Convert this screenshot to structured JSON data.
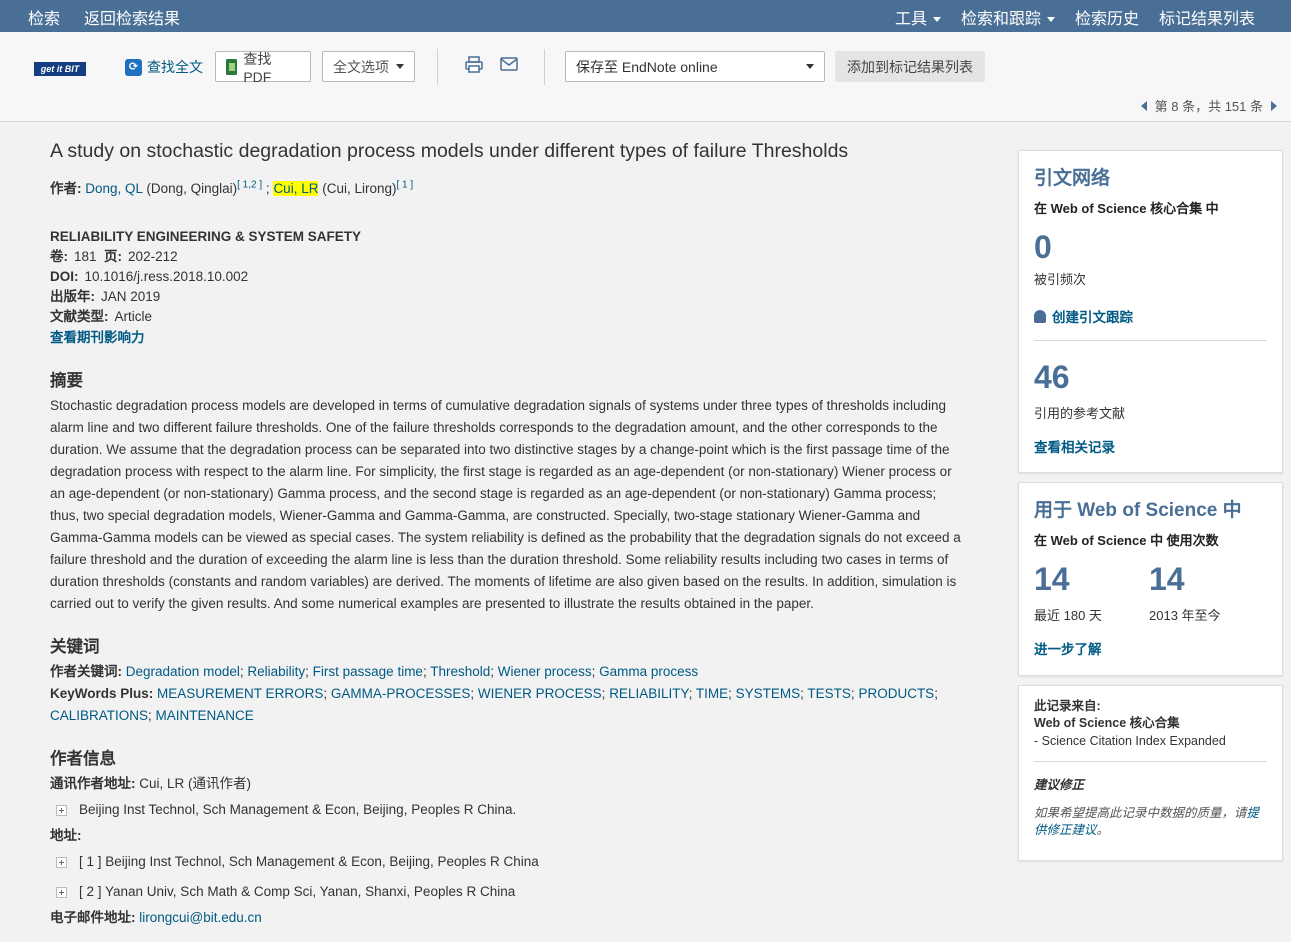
{
  "topbar": {
    "search": "检索",
    "back": "返回检索结果",
    "tools": "工具",
    "search_tracking": "检索和跟踪",
    "history": "检索历史",
    "marked_list": "标记结果列表"
  },
  "toolbar": {
    "getit": "get it BIT",
    "find_fulltext": "查找全文",
    "find_pdf": "查找 PDF",
    "fulltext_options": "全文选项",
    "save_to": "保存至 EndNote online",
    "add_to_marked": "添加到标记结果列表",
    "pager": "第 8 条，共 151 条"
  },
  "record": {
    "title": "A study on stochastic degradation process models under different types of failure Thresholds",
    "authors_label": "作者:",
    "author1_link": "Dong, QL",
    "author1_full": "(Dong, Qinglai)",
    "author1_sup": "[ 1,2 ]",
    "sep": ";",
    "author2_link": "Cui, LR",
    "author2_full": "(Cui, Lirong)",
    "author2_sup": "[ 1 ]",
    "journal": "RELIABILITY ENGINEERING & SYSTEM SAFETY",
    "volume_label": "卷:",
    "volume": "181",
    "pages_label": "页:",
    "pages": "202-212",
    "doi_label": "DOI:",
    "doi": "10.1016/j.ress.2018.10.002",
    "pubyear_label": "出版年:",
    "pubyear": "JAN 2019",
    "doctype_label": "文献类型:",
    "doctype": "Article",
    "impact_link": "查看期刊影响力"
  },
  "abstract": {
    "heading": "摘要",
    "text": "Stochastic degradation process models are developed in terms of cumulative degradation signals of systems under three types of thresholds including alarm line and two different failure thresholds. One of the failure thresholds corresponds to the degradation amount, and the other corresponds to the duration. We assume that the degradation process can be separated into two distinctive stages by a change-point which is the first passage time of the degradation process with respect to the alarm line. For simplicity, the first stage is regarded as an age-dependent (or non-stationary) Wiener process or an age-dependent (or non-stationary) Gamma process, and the second stage is regarded as an age-dependent (or non-stationary) Gamma process; thus, two special degradation models, Wiener-Gamma and Gamma-Gamma, are constructed. Specially, two-stage stationary Wiener-Gamma and Gamma-Gamma models can be viewed as special cases. The system reliability is defined as the probability that the degradation signals do not exceed a failure threshold and the duration of exceeding the alarm line is less than the duration threshold. Some reliability results including two cases in terms of duration thresholds (constants and random variables) are derived. The moments of lifetime are also given based on the results. In addition, simulation is carried out to verify the given results. And some numerical examples are presented to illustrate the results obtained in the paper."
  },
  "keywords": {
    "heading": "关键词",
    "author_label": "作者关键词:",
    "author_kw": [
      "Degradation model",
      "Reliability",
      "First passage time",
      "Threshold",
      "Wiener process",
      "Gamma process"
    ],
    "plus_label": "KeyWords Plus:",
    "plus_kw": [
      "MEASUREMENT ERRORS",
      "GAMMA-PROCESSES",
      "WIENER PROCESS",
      "RELIABILITY",
      "TIME",
      "SYSTEMS",
      "TESTS",
      "PRODUCTS",
      "CALIBRATIONS",
      "MAINTENANCE"
    ]
  },
  "author_info": {
    "heading": "作者信息",
    "corr_label": "通讯作者地址:",
    "corr_value": "Cui, LR (通讯作者)",
    "corr_addr": "Beijing Inst Technol, Sch Management & Econ, Beijing, Peoples R China.",
    "addr_label": "地址:",
    "addr1": "[ 1 ] Beijing Inst Technol, Sch Management & Econ, Beijing, Peoples R China",
    "addr2": "[ 2 ] Yanan Univ, Sch Math & Comp Sci, Yanan, Shanxi, Peoples R China",
    "email_label": "电子邮件地址:",
    "email": "lirongcui@bit.edu.cn"
  },
  "citation_network": {
    "heading": "引文网络",
    "in_core": "在 Web of Science 核心合集 中",
    "times_cited": "0",
    "times_cited_label": "被引频次",
    "create_alert": "创建引文跟踪",
    "refs": "46",
    "refs_label": "引用的参考文献",
    "related": "查看相关记录"
  },
  "usage": {
    "heading": "用于 Web of Science 中",
    "sub": "在 Web of Science 中 使用次数",
    "last180": "14",
    "last180_label": "最近 180 天",
    "since2013": "14",
    "since2013_label": "2013 年至今",
    "learn_more": "进一步了解"
  },
  "source": {
    "from_label": "此记录来自:",
    "collection": "Web of Science 核心合集",
    "index": "- Science Citation Index Expanded",
    "suggest_heading": "建议修正",
    "suggest_text": "如果希望提高此记录中数据的质量，请",
    "suggest_link": "提供修正建议",
    "suggest_end": "。"
  }
}
